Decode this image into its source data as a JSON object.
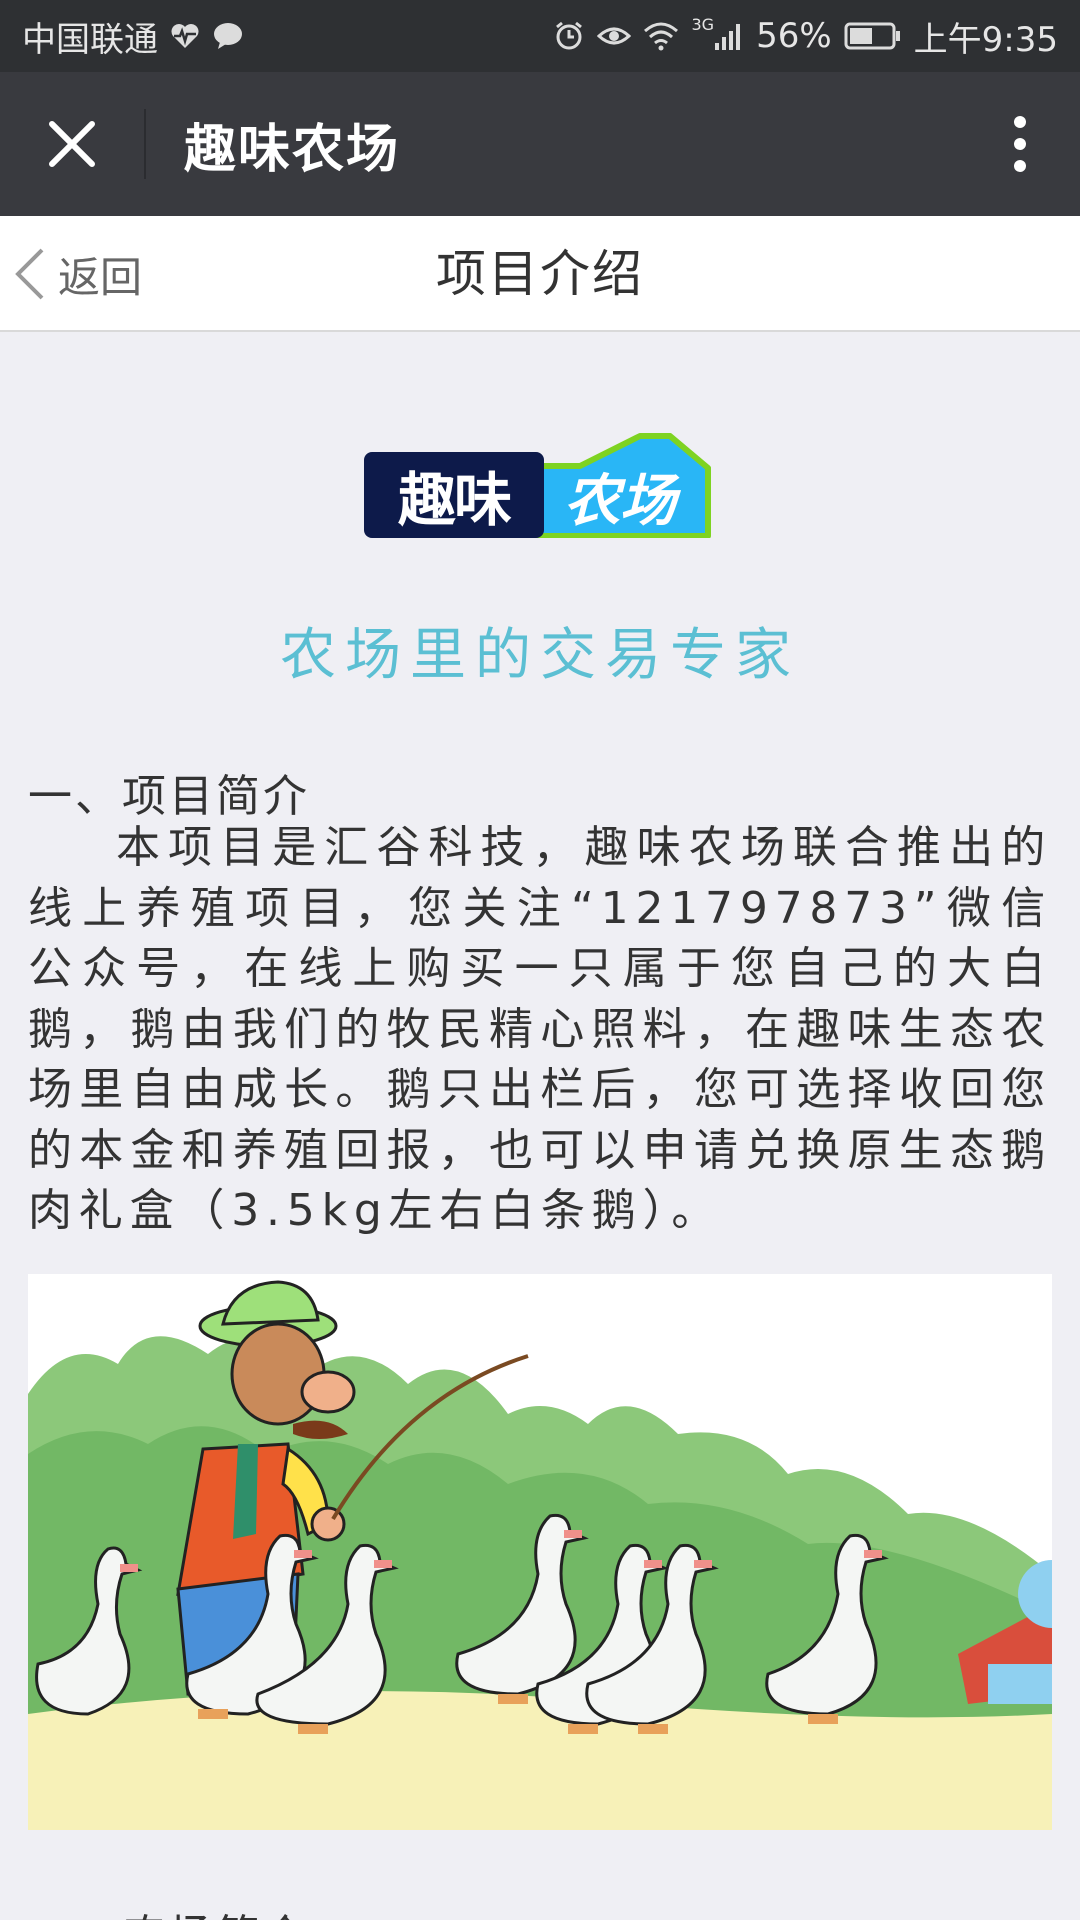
{
  "status_bar": {
    "carrier": "中国联通",
    "network": "3G",
    "battery": "56%",
    "time": "上午9:35"
  },
  "title_bar": {
    "title": "趣味农场",
    "close_icon": "close-icon",
    "more_icon": "more-vertical-icon"
  },
  "nav_bar": {
    "back_label": "返回",
    "title": "项目介绍"
  },
  "logo": {
    "left_text": "趣味",
    "right_text": "农场",
    "colors": {
      "dark": "#0d1a4a",
      "light": "#29b6f6",
      "border": "#7ed321"
    }
  },
  "content": {
    "slogan": "农场里的交易专家",
    "section1_heading": "一、项目简介",
    "section1_body": "本项目是汇谷科技，趣味农场联合推出的线上养殖项目，您关注“121797873”微信公众号，在线上购买一只属于您自己的大白鹅，鹅由我们的牧民精心照料，在趣味生态农场里自由成长。鹅只出栏后，您可选择收回您的本金和养殖回报，也可以申请兑换原生态鹅肉礼盒（3.5kg左右白条鹅）。",
    "section2_heading": "二、农场简介"
  },
  "colors": {
    "status_bar_bg": "#2e3033",
    "title_bar_bg": "#393a3f",
    "accent": "#5bbfd3",
    "page_bg": "#efeff4"
  }
}
